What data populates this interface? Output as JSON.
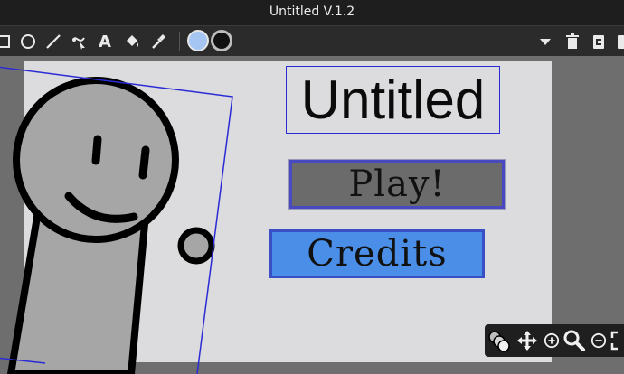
{
  "window": {
    "title": "Untitled V.1.2"
  },
  "toolbar": {
    "left_tools": [
      {
        "name": "select-rect-icon"
      },
      {
        "name": "ellipse-tool-icon"
      },
      {
        "name": "line-tool-icon"
      },
      {
        "name": "reshape-tool-icon"
      },
      {
        "name": "text-tool-icon",
        "glyph": "A"
      },
      {
        "name": "fill-bucket-icon"
      },
      {
        "name": "eyedropper-icon"
      }
    ],
    "fill_color": "#a5c5f2",
    "stroke_color": "#111111",
    "right_tools": [
      {
        "name": "dropdown-arrow-icon"
      },
      {
        "name": "trash-icon"
      },
      {
        "name": "copy-icon"
      },
      {
        "name": "paste-icon"
      }
    ]
  },
  "stage": {
    "title_label": "Untitled",
    "play_label": "Play!",
    "credits_label": "Credits",
    "play_color": "#6b6b6b",
    "credits_color": "#4a8ee8"
  },
  "nav": {
    "icons": [
      "layers-icon",
      "move-icon",
      "zoom-in-icon",
      "magnifier-icon",
      "zoom-out-icon",
      "fullscreen-icon"
    ]
  }
}
